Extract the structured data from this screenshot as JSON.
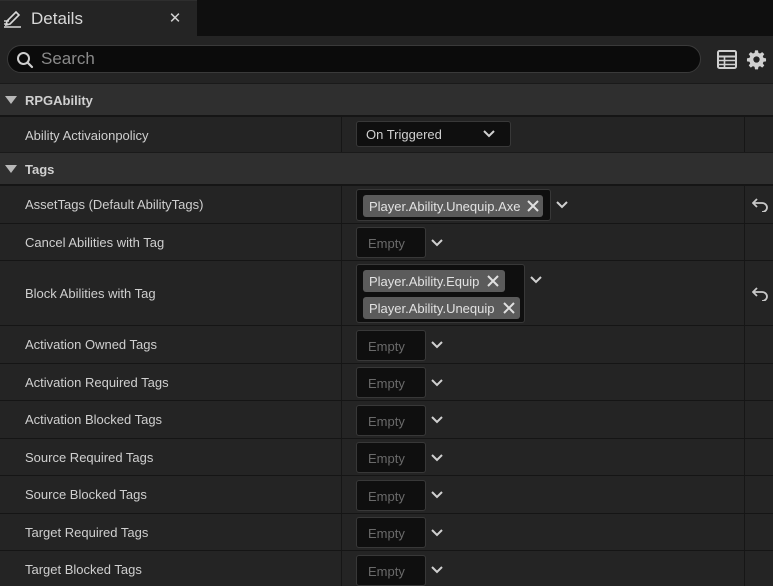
{
  "tab": {
    "title": "Details",
    "close": "✕",
    "icon": "pencil-icon"
  },
  "search": {
    "placeholder": "Search"
  },
  "toolbar": {
    "icons": [
      "table-view-icon",
      "gear-icon"
    ]
  },
  "categories": [
    {
      "label": "RPGAbility"
    },
    {
      "label": "Tags"
    }
  ],
  "rpg_ability": {
    "policy_label": "Ability Activaionpolicy",
    "policy_value": "On Triggered"
  },
  "tags": {
    "empty_text": "Empty",
    "asset_tags": {
      "label": "AssetTags (Default AbilityTags)",
      "chips": [
        "Player.Ability.Unequip.Axe"
      ]
    },
    "cancel": {
      "label": "Cancel Abilities with Tag"
    },
    "block": {
      "label": "Block Abilities with Tag",
      "chips": [
        "Player.Ability.Equip",
        "Player.Ability.Unequip"
      ]
    },
    "activation_owned": {
      "label": "Activation Owned Tags"
    },
    "activation_required": {
      "label": "Activation Required Tags"
    },
    "activation_blocked": {
      "label": "Activation Blocked Tags"
    },
    "source_required": {
      "label": "Source Required Tags"
    },
    "source_blocked": {
      "label": "Source Blocked Tags"
    },
    "target_required": {
      "label": "Target Required Tags"
    },
    "target_blocked": {
      "label": "Target Blocked Tags"
    }
  },
  "colors": {
    "panel": "#242424",
    "category": "#2f2f2f",
    "field": "#0f0f0f",
    "chip": "#5b5b5b"
  }
}
